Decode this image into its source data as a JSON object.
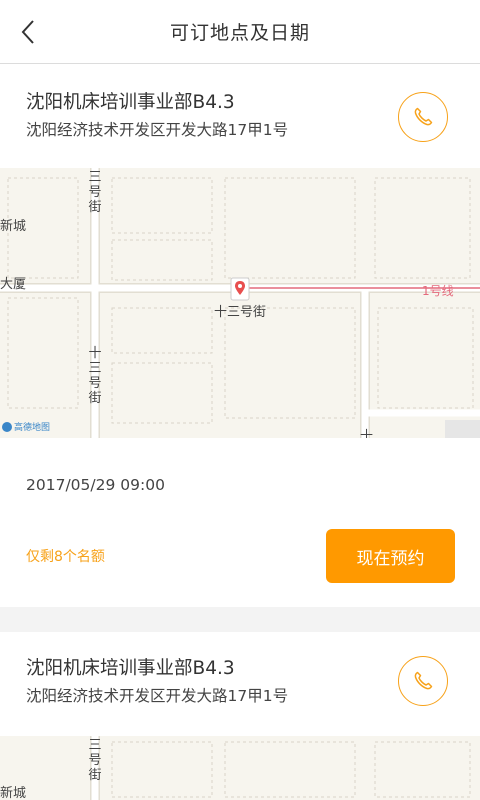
{
  "header": {
    "title": "可订地点及日期"
  },
  "locations": [
    {
      "name": "沈阳机床培训事业部B4.3",
      "address": "沈阳经济技术开发区开发大路17甲1号",
      "map": {
        "labels": {
          "district": "新城",
          "building": "大厦",
          "road_vertical": "三号街",
          "road_vertical_lower": "十三号街",
          "poi": "十三号街",
          "metro": "1号线",
          "logo": "高德地图",
          "partial_char": "十"
        }
      },
      "datetime": "2017/05/29 09:00",
      "quota": "仅剩8个名额",
      "book_label": "现在预约"
    },
    {
      "name": "沈阳机床培训事业部B4.3",
      "address": "沈阳经济技术开发区开发大路17甲1号",
      "map": {
        "labels": {
          "district": "新城",
          "road_vertical": "三号街"
        }
      }
    }
  ],
  "colors": {
    "accent": "#ff9900",
    "accent_outline": "#f7a21a",
    "metro_line": "#e46a7c"
  },
  "icons": {
    "back": "chevron-left-icon",
    "phone": "phone-icon",
    "map_pin": "map-pin-icon"
  }
}
